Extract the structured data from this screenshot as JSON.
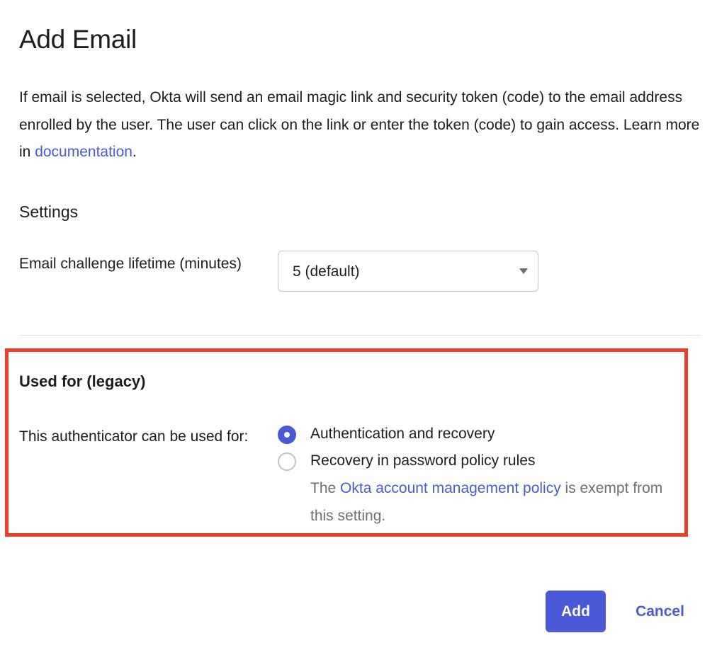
{
  "dialog": {
    "title": "Add Email",
    "intro_before_link": "If email is selected, Okta will send an email magic link and security token (code) to the email address enrolled by the user. The user can click on the link or enter the token (code) to gain access. Learn more in ",
    "intro_link": "documentation",
    "intro_after_link": "."
  },
  "settings": {
    "heading": "Settings",
    "lifetime_label": "Email challenge lifetime (minutes)",
    "lifetime_value": "5 (default)"
  },
  "legacy": {
    "heading": "Used for (legacy)",
    "used_for_label": "This authenticator can be used for:",
    "options": [
      {
        "label": "Authentication and recovery",
        "selected": true
      },
      {
        "label": "Recovery in password policy rules",
        "selected": false
      }
    ],
    "hint_before_link": "The ",
    "hint_link": "Okta account management policy",
    "hint_after_link": " is exempt from this setting."
  },
  "footer": {
    "add_label": "Add",
    "cancel_label": "Cancel"
  },
  "colors": {
    "accent": "#4a5ad6",
    "highlight_border": "#e8402c",
    "muted_text": "#6e6e78"
  }
}
